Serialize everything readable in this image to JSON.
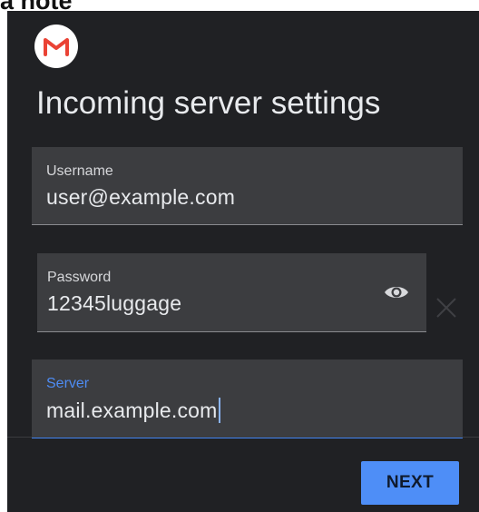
{
  "caption": "a note",
  "screen": {
    "logo_icon": "gmail-icon",
    "title": "Incoming server settings",
    "fields": {
      "username": {
        "label": "Username",
        "value": "user@example.com"
      },
      "password": {
        "label": "Password",
        "value": "12345luggage",
        "toggle_icon": "eye-icon"
      },
      "server": {
        "label": "Server",
        "value": "mail.example.com"
      }
    },
    "clear_icon": "close-icon",
    "next_label": "NEXT"
  },
  "colors": {
    "background": "#202124",
    "field": "#3c3d40",
    "accent": "#4285f4",
    "button": "#4e8ef7",
    "gmail_red": "#ea4335"
  }
}
